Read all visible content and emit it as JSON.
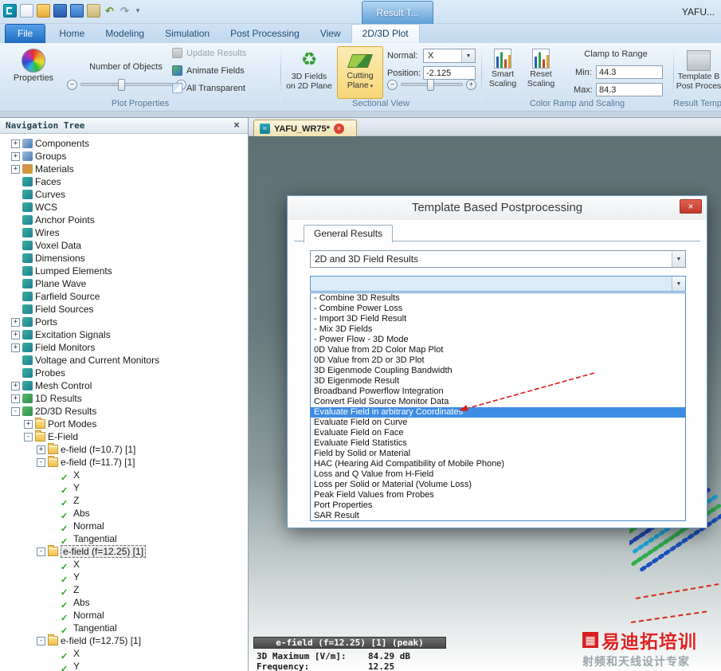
{
  "icons": {
    "close": "×",
    "caret_down": "▾",
    "combo_arrow": "▼",
    "minus": "−",
    "plus": "+",
    "undo": "↶",
    "redo": "↷",
    "wave": "≈",
    "fields3d": "♻",
    "grid": "▦"
  },
  "titlebar": {
    "floating_tab": "Result T...",
    "app_title": "YAFU..."
  },
  "ribbon": {
    "tabs": [
      {
        "label": "File",
        "cls": "file"
      },
      {
        "label": "Home"
      },
      {
        "label": "Modeling"
      },
      {
        "label": "Simulation"
      },
      {
        "label": "Post Processing"
      },
      {
        "label": "View"
      },
      {
        "label": "2D/3D Plot",
        "cls": "active"
      }
    ],
    "plot_properties": {
      "group_label": "Plot Properties",
      "properties": "Properties",
      "number_of_objects": "Number of Objects",
      "update_results": "Update Results",
      "animate_fields": "Animate Fields",
      "all_transparent": "All Transparent"
    },
    "sectional_view": {
      "group_label": "Sectional View",
      "fields3d_l1": "3D Fields",
      "fields3d_l2": "on 2D Plane",
      "cutting_l1": "Cutting",
      "cutting_l2": "Plane",
      "normal_label": "Normal:",
      "normal_value": "X",
      "position_label": "Position:",
      "position_value": "-2.125"
    },
    "color_ramp": {
      "group_label": "Color Ramp and Scaling",
      "smart_l1": "Smart",
      "smart_l2": "Scaling",
      "reset_l1": "Reset",
      "reset_l2": "Scaling",
      "clamp_label": "Clamp to Range",
      "min_label": "Min:",
      "min_value": "44.3",
      "max_label": "Max:",
      "max_value": "84.3"
    },
    "result_templates": {
      "group_label": "Result Temp",
      "btn_l1": "Template B",
      "btn_l2": "Post Proces"
    }
  },
  "nav": {
    "header": "Navigation Tree",
    "items": [
      {
        "label": "Components",
        "level": 0,
        "exp": "+",
        "icon": "comp"
      },
      {
        "label": "Groups",
        "level": 0,
        "exp": "+",
        "icon": "comp"
      },
      {
        "label": "Materials",
        "level": 0,
        "exp": "+",
        "icon": "mat"
      },
      {
        "label": "Faces",
        "level": 0,
        "exp": "",
        "icon": "g"
      },
      {
        "label": "Curves",
        "level": 0,
        "exp": "",
        "icon": "g"
      },
      {
        "label": "WCS",
        "level": 0,
        "exp": "",
        "icon": "g"
      },
      {
        "label": "Anchor Points",
        "level": 0,
        "exp": "",
        "icon": "g"
      },
      {
        "label": "Wires",
        "level": 0,
        "exp": "",
        "icon": "g"
      },
      {
        "label": "Voxel Data",
        "level": 0,
        "exp": "",
        "icon": "g"
      },
      {
        "label": "Dimensions",
        "level": 0,
        "exp": "",
        "icon": "g"
      },
      {
        "label": "Lumped Elements",
        "level": 0,
        "exp": "",
        "icon": "g"
      },
      {
        "label": "Plane Wave",
        "level": 0,
        "exp": "",
        "icon": "g"
      },
      {
        "label": "Farfield Source",
        "level": 0,
        "exp": "",
        "icon": "g"
      },
      {
        "label": "Field Sources",
        "level": 0,
        "exp": "",
        "icon": "g"
      },
      {
        "label": "Ports",
        "level": 0,
        "exp": "+",
        "icon": "g"
      },
      {
        "label": "Excitation Signals",
        "level": 0,
        "exp": "+",
        "icon": "g"
      },
      {
        "label": "Field Monitors",
        "level": 0,
        "exp": "+",
        "icon": "g"
      },
      {
        "label": "Voltage and Current Monitors",
        "level": 0,
        "exp": "",
        "icon": "g"
      },
      {
        "label": "Probes",
        "level": 0,
        "exp": "",
        "icon": "g"
      },
      {
        "label": "Mesh Control",
        "level": 0,
        "exp": "+",
        "icon": "g"
      },
      {
        "label": "1D Results",
        "level": 0,
        "exp": "+",
        "icon": "res"
      },
      {
        "label": "2D/3D Results",
        "level": 0,
        "exp": "-",
        "icon": "res"
      },
      {
        "label": "Port Modes",
        "level": 1,
        "exp": "+",
        "icon": "f"
      },
      {
        "label": "E-Field",
        "level": 1,
        "exp": "-",
        "icon": "f"
      },
      {
        "label": "e-field (f=10.7) [1]",
        "level": 2,
        "exp": "+",
        "icon": "f"
      },
      {
        "label": "e-field (f=11.7) [1]",
        "level": 2,
        "exp": "-",
        "icon": "f"
      },
      {
        "label": "X",
        "level": 3,
        "exp": "",
        "icon": "c"
      },
      {
        "label": "Y",
        "level": 3,
        "exp": "",
        "icon": "c"
      },
      {
        "label": "Z",
        "level": 3,
        "exp": "",
        "icon": "c"
      },
      {
        "label": "Abs",
        "level": 3,
        "exp": "",
        "icon": "c"
      },
      {
        "label": "Normal",
        "level": 3,
        "exp": "",
        "icon": "c"
      },
      {
        "label": "Tangential",
        "level": 3,
        "exp": "",
        "icon": "c"
      },
      {
        "label": "e-field (f=12.25) [1]",
        "level": 2,
        "exp": "-",
        "icon": "f",
        "selected": true
      },
      {
        "label": "X",
        "level": 3,
        "exp": "",
        "icon": "c"
      },
      {
        "label": "Y",
        "level": 3,
        "exp": "",
        "icon": "c"
      },
      {
        "label": "Z",
        "level": 3,
        "exp": "",
        "icon": "c"
      },
      {
        "label": "Abs",
        "level": 3,
        "exp": "",
        "icon": "c"
      },
      {
        "label": "Normal",
        "level": 3,
        "exp": "",
        "icon": "c"
      },
      {
        "label": "Tangential",
        "level": 3,
        "exp": "",
        "icon": "c"
      },
      {
        "label": "e-field (f=12.75) [1]",
        "level": 2,
        "exp": "-",
        "icon": "f"
      },
      {
        "label": "X",
        "level": 3,
        "exp": "",
        "icon": "c"
      },
      {
        "label": "Y",
        "level": 3,
        "exp": "",
        "icon": "c"
      }
    ]
  },
  "doc_tab": {
    "label": "YAFU_WR75*"
  },
  "dialog": {
    "title": "Template Based Postprocessing",
    "tab_label": "General Results",
    "combo1_value": "2D and 3D Field Results",
    "list_items": [
      "- Combine 3D Results",
      "- Combine Power Loss",
      "- Import 3D Field Result",
      "- Mix 3D Fields",
      "- Power Flow - 3D Mode",
      "0D Value from 2D Color Map Plot",
      "0D Value from 2D or 3D Plot",
      "3D Eigenmode Coupling Bandwidth",
      "3D Eigenmode Result",
      "Broadband Powerflow Integration",
      "Convert Field Source Monitor Data",
      {
        "label": "Evaluate Field in arbitrary Coordinates",
        "selected": true
      },
      "Evaluate Field on Curve",
      "Evaluate Field on Face",
      "Evaluate Field Statistics",
      "Field by Solid or Material",
      "HAC (Hearing Aid Compatibility of Mobile Phone)",
      "Loss and Q Value from H-Field",
      "Loss per Solid or Material (Volume Loss)",
      "Peak Field Values from Probes",
      "Port Properties",
      "SAR Result"
    ]
  },
  "status": {
    "legend": "e-field (f=12.25) [1] (peak)",
    "rows": [
      {
        "label": "3D Maximum [V/m]:",
        "value": "84.29 dB"
      },
      {
        "label": "Frequency:",
        "value": "12.25"
      }
    ]
  },
  "watermark": {
    "line1": "易迪拓培训",
    "line2": "射频和天线设计专家"
  }
}
